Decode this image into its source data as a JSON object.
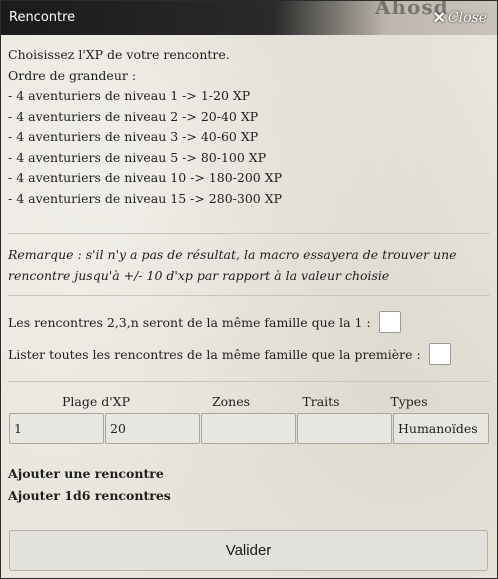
{
  "window": {
    "title": "Rencontre",
    "background_map_text": "Ahosd",
    "close_label": "Close",
    "close_icon": "close-icon"
  },
  "intro": {
    "lines": [
      "Choisissez l'XP de votre rencontre.",
      "Ordre de grandeur :",
      "- 4 aventuriers de niveau 1 -> 1-20 XP",
      "- 4 aventuriers de niveau 2 -> 20-40 XP",
      "- 4 aventuriers de niveau 3 -> 40-60 XP",
      "- 4 aventuriers de niveau 5 -> 80-100 XP",
      "- 4 aventuriers de niveau 10 -> 180-200 XP",
      "- 4 aventuriers de niveau 15 -> 280-300 XP"
    ]
  },
  "remark": "Remarque : s'il n'y a pas de résultat, la macro essayera de trouver une rencontre jusqu'à +/- 10 d'xp par rapport à la valeur choisie",
  "options": {
    "same_family_label": "Les rencontres 2,3,n seront de la même famille que la 1 :",
    "same_family_checked": false,
    "list_family_label": "Lister toutes les rencontres de la même famille que la première :",
    "list_family_checked": false
  },
  "filters": {
    "xp_range_label": "Plage d'XP",
    "zones_label": "Zones",
    "traits_label": "Traits",
    "types_label": "Types",
    "xp_min_value": "1",
    "xp_max_value": "20",
    "zones_value": "",
    "traits_value": "",
    "types_value": "Humanoïdes"
  },
  "actions": {
    "add_one": "Ajouter une rencontre",
    "add_1d6": "Ajouter 1d6 rencontres",
    "validate": "Valider"
  }
}
